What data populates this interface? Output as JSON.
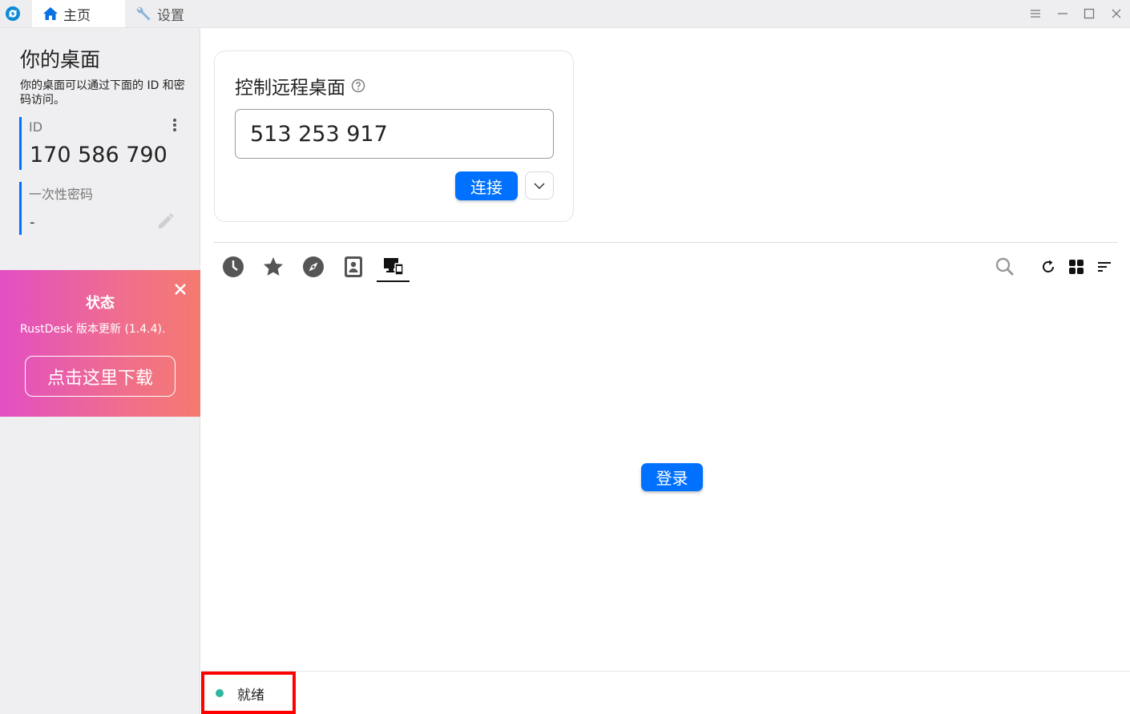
{
  "titlebar": {
    "tabs": [
      {
        "label": "主页",
        "icon": "home-icon"
      },
      {
        "label": "设置",
        "icon": "wrench-icon"
      }
    ],
    "window_controls": [
      "menu-icon",
      "minimize-icon",
      "maximize-icon",
      "close-icon"
    ]
  },
  "sidebar": {
    "title": "你的桌面",
    "description": "你的桌面可以通过下面的 ID 和密码访问。",
    "id_label": "ID",
    "id_value": "170 586 790",
    "password_label": "一次性密码",
    "password_value": "-"
  },
  "status_card": {
    "title": "状态",
    "text": "RustDesk 版本更新 (1.4.4).",
    "button": "点击这里下载"
  },
  "connect_card": {
    "title": "控制远程桌面",
    "remote_id_value": "513 253 917",
    "connect_label": "连接"
  },
  "peer_tabs": [
    "recent-icon",
    "favorites-icon",
    "discovered-icon",
    "address-book-icon",
    "group-icon"
  ],
  "main": {
    "login_label": "登录"
  },
  "statusbar": {
    "status_text": "就绪"
  },
  "colors": {
    "accent": "#0071ff",
    "status_ok": "#2fb6a0",
    "status_card_gradient_start": "#e24fc3",
    "status_card_gradient_end": "#f47a70",
    "highlight": "#ff0000"
  }
}
